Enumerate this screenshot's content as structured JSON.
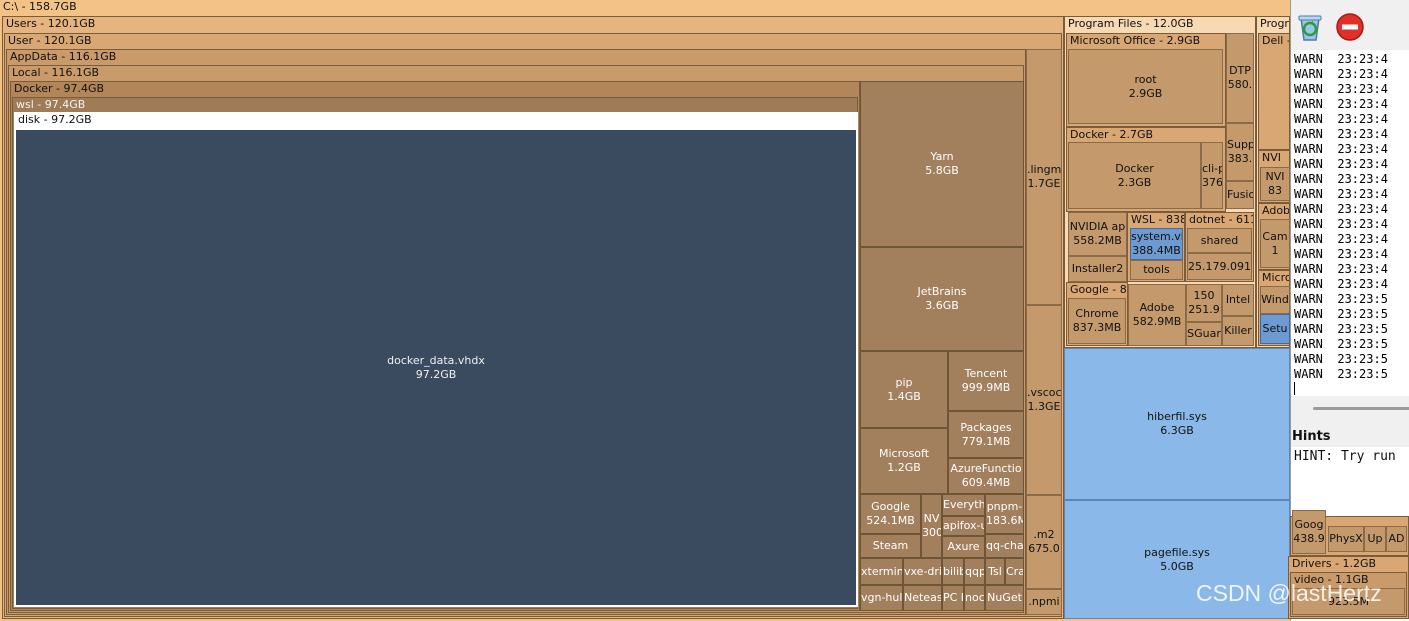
{
  "treemap": {
    "root": "C:\\ - 158.7GB",
    "users": "Users - 120.1GB",
    "user": "User - 120.1GB",
    "appdata": "AppData - 116.1GB",
    "local": "Local - 116.1GB",
    "docker": "Docker - 97.4GB",
    "wsl": "wsl - 97.4GB",
    "disk": "disk - 97.2GB",
    "disk_file": {
      "name": "docker_data.vhdx",
      "size": "97.2GB"
    },
    "yarn": {
      "name": "Yarn",
      "size": "5.8GB"
    },
    "jetbrains": {
      "name": "JetBrains",
      "size": "3.6GB"
    },
    "pip": {
      "name": "pip",
      "size": "1.4GB"
    },
    "tencent": {
      "name": "Tencent",
      "size": "999.9MB"
    },
    "microsoft_local": {
      "name": "Microsoft",
      "size": "1.2GB"
    },
    "packages": {
      "name": "Packages",
      "size": "779.1MB"
    },
    "azurefunctions": {
      "name": "AzureFunctio",
      "size": "609.4MB"
    },
    "google_local": {
      "name": "Google",
      "size": "524.1MB"
    },
    "nv": {
      "name": "NV",
      "size": "300"
    },
    "everything": "Everyth",
    "pnpm": {
      "name": "pnpm-",
      "size": "183.6M"
    },
    "apifox": "apifox-u",
    "steam": "Steam",
    "axure": "Axure",
    "qqcha": "qq-cha",
    "xtermin": "xtermin",
    "vxedri": "vxe-dri",
    "bilib": "bilib",
    "qqp": "qqp",
    "tsl": "Tsl",
    "cra": "Cra",
    "vgnhul": "vgn-hul",
    "neteas": "Neteas",
    "pcm": "PC M",
    "noc": "noc",
    "nuget": "NuGet",
    "lingma": {
      "name": ".lingm",
      "size": "1.7GE"
    },
    "vscode": {
      "name": ".vscoc",
      "size": "1.3GE"
    },
    "m2": {
      "name": ".m2",
      "size": "675.0"
    },
    "npm": ".npmi",
    "program_files": "Program Files - 12.0GB",
    "ms_office": "Microsoft Office - 2.9GB",
    "office_root": {
      "name": "root",
      "size": "2.9GB"
    },
    "dtp": {
      "name": "DTP",
      "size": "580."
    },
    "supp": {
      "name": "Supp",
      "size": "383."
    },
    "fusio": "Fusio",
    "docker_pf": "Docker - 2.7GB",
    "docker_pf_inner": {
      "name": "Docker",
      "size": "2.3GB"
    },
    "clip": {
      "name": "cli-p",
      "size": "376"
    },
    "nvidia_ap": {
      "name": "NVIDIA ap",
      "size": "558.2MB"
    },
    "wsl_pf": "WSL - 838",
    "system_vhd": {
      "name": "system.vl",
      "size": "388.4MB"
    },
    "tools": "tools",
    "dotnet": "dotnet - 611",
    "shared": "shared",
    "dotnet_ver": "25.179.091",
    "installer2": "Installer2",
    "google_pf": "Google - 8",
    "chrome": {
      "name": "Chrome",
      "size": "837.3MB"
    },
    "adobe_pf": {
      "name": "Adobe",
      "size": "582.9MB"
    },
    "v150": {
      "name": "150",
      "size": "251.9"
    },
    "intel": "Intel",
    "sguar": "SGuar",
    "killer": "Killer",
    "hiberfil": {
      "name": "hiberfil.sys",
      "size": "6.3GB"
    },
    "pagefile": {
      "name": "pagefile.sys",
      "size": "5.0GB"
    },
    "progx86": "Progra",
    "dell": "Dell -",
    "nvi_hdr": "NVI",
    "nvi_in": {
      "name": "NVI",
      "size": "83"
    },
    "adob_hdr": "Adob",
    "cam": {
      "name": "Cam",
      "size": "1"
    },
    "micro_hdr": "Micro",
    "wind": "Wind",
    "setu": "Setu",
    "drivers": "Drivers - 1.2GB",
    "video": "video - 1.1GB",
    "video_sz": "923.5M",
    "goog_small": {
      "name": "Goog",
      "size": "438.9"
    },
    "physx": "PhysX",
    "up": "Up",
    "ad": "AD"
  },
  "log": {
    "lines": [
      "WARN  23:23:4",
      "WARN  23:23:4",
      "WARN  23:23:4",
      "WARN  23:23:4",
      "WARN  23:23:4",
      "WARN  23:23:4",
      "WARN  23:23:4",
      "WARN  23:23:4",
      "WARN  23:23:4",
      "WARN  23:23:4",
      "WARN  23:23:4",
      "WARN  23:23:4",
      "WARN  23:23:4",
      "WARN  23:23:4",
      "WARN  23:23:4",
      "WARN  23:23:4",
      "WARN  23:23:5",
      "WARN  23:23:5",
      "WARN  23:23:5",
      "WARN  23:23:5",
      "WARN  23:23:5",
      "WARN  23:23:5"
    ],
    "hints_title": "Hints",
    "hint": "HINT: Try run"
  },
  "watermark": "CSDN @lastHertz",
  "icons": {
    "recycle": "recycle-bin-icon",
    "stop": "stop-icon"
  },
  "colors": {
    "background": "#f4b13a",
    "selected": "#3a4b5f",
    "highlight": "#8ab8e8"
  }
}
